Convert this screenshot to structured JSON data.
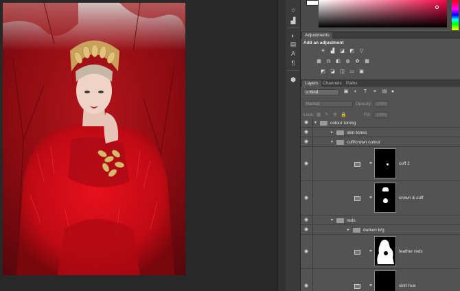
{
  "panels": {
    "adjustments": {
      "tab": "Adjustments",
      "heading": "Add an adjustment",
      "icons": [
        "brightness-contrast-icon",
        "levels-icon",
        "curves-icon",
        "exposure-icon",
        "vibrance-icon",
        "hue-saturation-icon",
        "color-balance-icon",
        "black-white-icon",
        "photo-filter-icon",
        "channel-mixer-icon",
        "color-lookup-icon",
        "invert-icon",
        "posterize-icon",
        "threshold-icon",
        "gradient-map-icon",
        "selective-color-icon"
      ]
    },
    "layers": {
      "tabs": [
        "Layers",
        "Channels",
        "Paths"
      ],
      "filter_kind": "Kind",
      "blend_mode": "Normal",
      "opacity_label": "Opacity:",
      "opacity_value": "100%",
      "lock_label": "Lock:",
      "fill_label": "Fill:",
      "fill_value": "100%",
      "items": [
        {
          "name": "colour toning"
        },
        {
          "name": "skin tones"
        },
        {
          "name": "cuff/crown colour"
        },
        {
          "name": "cuff 2"
        },
        {
          "name": "crown & cuff"
        },
        {
          "name": "reds"
        },
        {
          "name": "darken b/g"
        },
        {
          "name": "feather reds"
        },
        {
          "name": "skirt hue"
        }
      ]
    }
  },
  "colors": {
    "canvas_bg": "#282828",
    "panel_bg": "#535353",
    "picker_hue": "#f40a46"
  }
}
